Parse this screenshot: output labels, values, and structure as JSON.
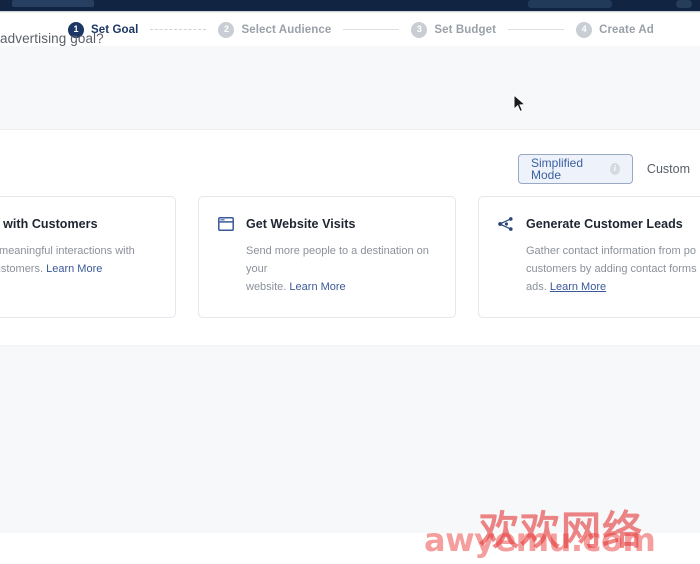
{
  "appbar": {
    "name": "application-title-bar"
  },
  "stepper": {
    "steps": [
      {
        "number": "1",
        "label": "Set Goal",
        "state": "active"
      },
      {
        "number": "2",
        "label": "Select Audience",
        "state": "inactive"
      },
      {
        "number": "3",
        "label": "Set Budget",
        "state": "inactive"
      },
      {
        "number": "4",
        "label": "Create Ad",
        "state": "inactive"
      }
    ]
  },
  "main": {
    "goal_question": "advertising goal?",
    "mode_toggle": {
      "simplified_label": "Simplified Mode",
      "simplified_info_glyph": "i",
      "custom_label": "Custom"
    },
    "cards": [
      {
        "title": "nnect with Customers",
        "desc_line1": "age in meaningful interactions with",
        "desc_line2": "ntial customers.",
        "learn_more": "Learn More",
        "icon": "people-icon"
      },
      {
        "title": "Get Website Visits",
        "desc_line1": "Send more people to a destination on your",
        "desc_line2": "website.",
        "learn_more": "Learn More",
        "icon": "browser-window-icon"
      },
      {
        "title": "Generate Customer Leads",
        "desc_line1": "Gather contact information from po",
        "desc_line2": "customers by adding contact forms",
        "desc_line3": "ads.",
        "learn_more": "Learn More",
        "icon": "share-nodes-icon"
      }
    ]
  },
  "watermark": {
    "chinese": "欢欢网络",
    "latin": "awyemu.com"
  },
  "colors": {
    "appbar": "#112441",
    "active_step": "#1c3764",
    "inactive_step": "#c9cdd4",
    "link": "#3b5998",
    "selected_tab_bg": "#eef3fb",
    "band_gray": "#f7f8fa",
    "card_border": "#e4e7ec"
  }
}
